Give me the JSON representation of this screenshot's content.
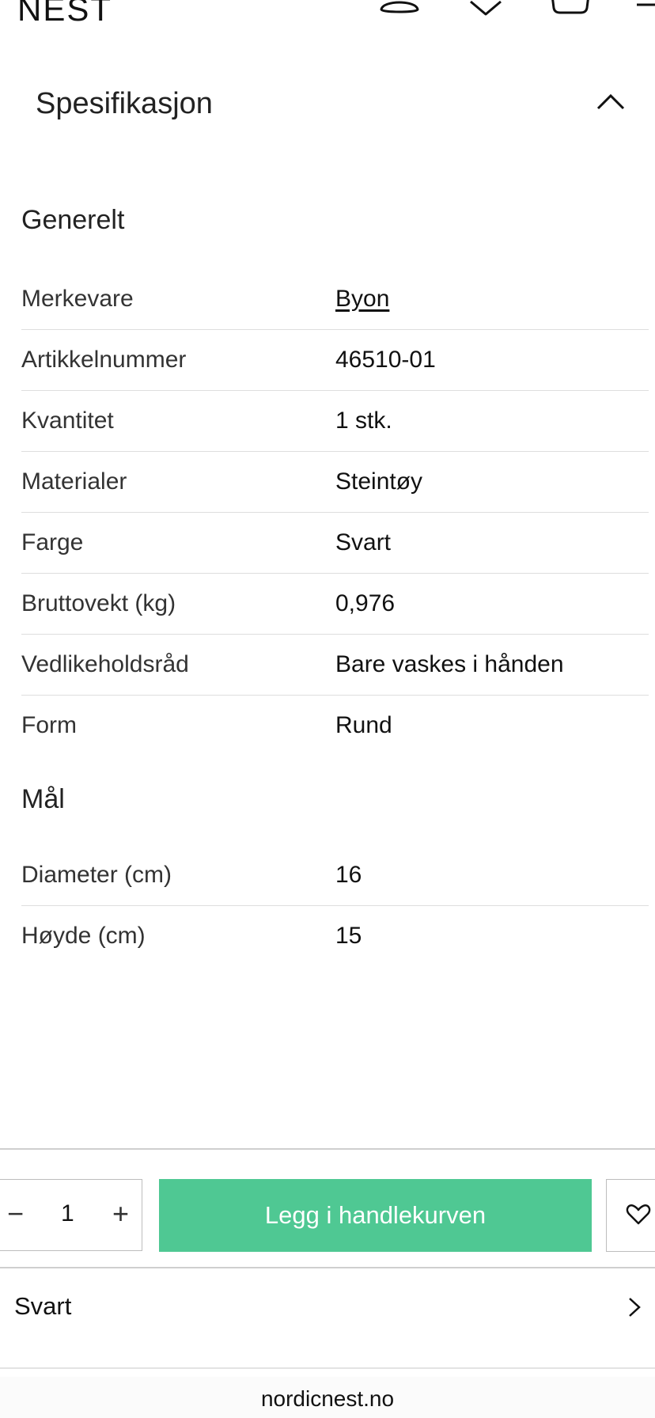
{
  "header": {
    "logo": "NEST",
    "icons": [
      "user-icon",
      "heart-icon",
      "bag-icon",
      "menu-icon"
    ]
  },
  "accordion": {
    "title": "Spesifikasjon"
  },
  "general": {
    "title": "Generelt",
    "rows": [
      {
        "label": "Merkevare",
        "value": "Byon"
      },
      {
        "label": "Artikkelnummer",
        "value": "46510-01"
      },
      {
        "label": "Kvantitet",
        "value": "1 stk."
      },
      {
        "label": "Materialer",
        "value": "Steintøy"
      },
      {
        "label": "Farge",
        "value": "Svart"
      },
      {
        "label": "Bruttovekt (kg)",
        "value": "0,976"
      },
      {
        "label": "Vedlikeholdsråd",
        "value": "Bare vaskes i hånden"
      },
      {
        "label": "Form",
        "value": "Rund"
      }
    ]
  },
  "dimensions": {
    "title": "Mål",
    "rows": [
      {
        "label": "Diameter (cm)",
        "value": "16"
      },
      {
        "label": "Høyde (cm)",
        "value": "15"
      }
    ]
  },
  "purchase": {
    "minus": "−",
    "quantity": "1",
    "plus": "+",
    "add_label": "Legg i handlekurven",
    "add_color": "#4fc893"
  },
  "variant": {
    "label": "Svart"
  },
  "browser": {
    "url": "nordicnest.no"
  }
}
